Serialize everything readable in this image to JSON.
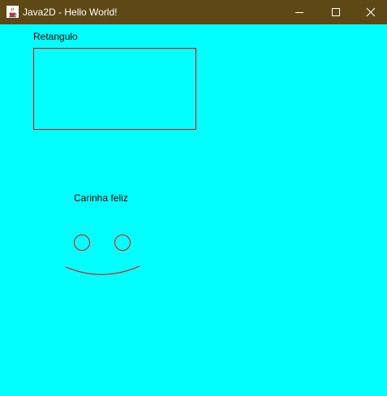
{
  "window": {
    "title": "Java2D - Hello World!",
    "titlebar_color": "#5e4816",
    "background_color": "#00ffff"
  },
  "titlebar_buttons": {
    "minimize_icon": "minimize-icon",
    "maximize_icon": "maximize-icon",
    "close_icon": "close-icon"
  },
  "canvas": {
    "rectangle_label": "Retangulo",
    "face_label": "Carinha feliz",
    "shape_stroke_color": "#ff0000",
    "label_color": "#000000"
  }
}
